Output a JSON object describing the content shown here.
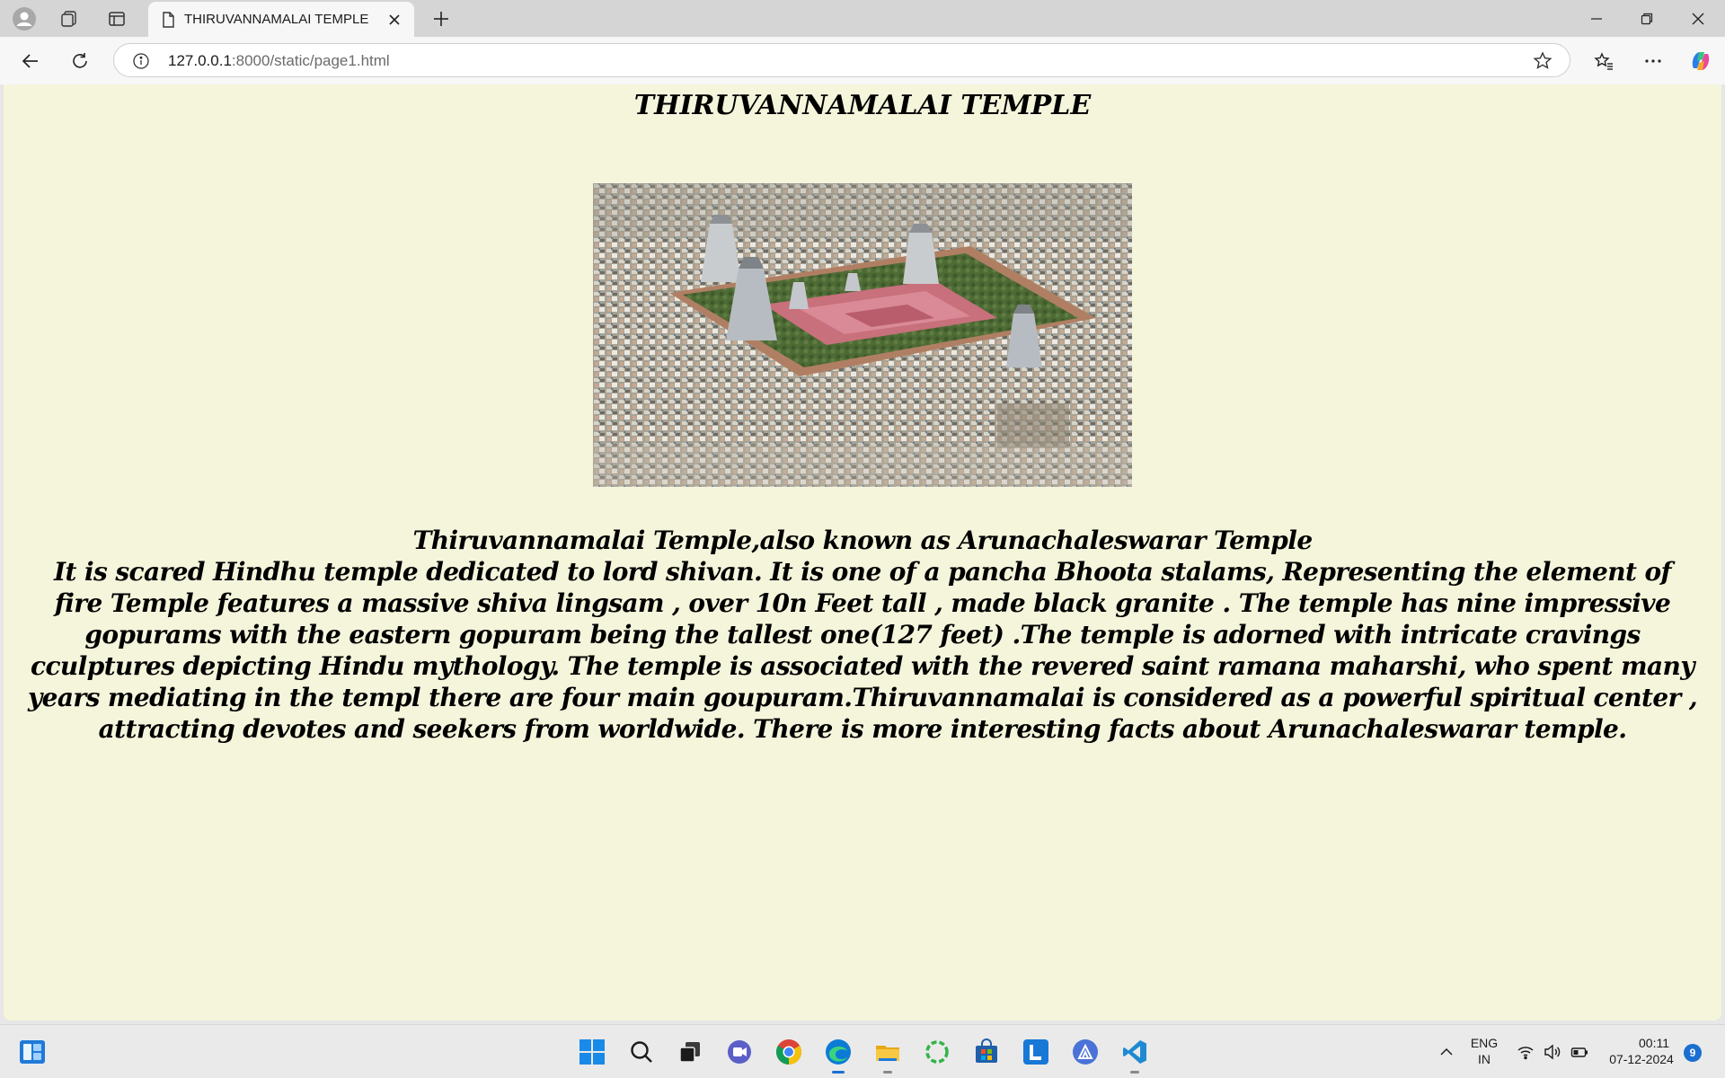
{
  "browser": {
    "tab_title": "THIRUVANNAMALAI TEMPLE",
    "url_host": "127.0.0.1",
    "url_path": ":8000/static/page1.html"
  },
  "page": {
    "heading": "THIRUVANNAMALAI TEMPLE",
    "image_alt": "Aerial view of Thiruvannamalai temple",
    "intro": "Thiruvannamalai Temple,also known as Arunachaleswarar Temple",
    "body": "It is scared Hindhu temple dedicated to lord shivan. It is one of a pancha Bhoota stalams, Representing the element of fire Temple features a massive shiva lingsam , over 10n Feet tall , made black granite . The temple has nine impressive gopurams with the eastern gopuram being the tallest one(127 feet) .The temple is adorned with intricate cravings cculptures depicting Hindu mythology. The temple is associated with the revered saint ramana maharshi, who spent many years mediating in the templ there are four main goupuram.Thiruvannamalai is considered as a powerful spiritual center , attracting devotes and seekers from worldwide. There is more interesting facts about Arunachaleswarar temple."
  },
  "taskbar": {
    "lang_top": "ENG",
    "lang_bottom": "IN",
    "time": "00:11",
    "date": "07-12-2024",
    "notification_count": "9",
    "icons": [
      "widgets-icon",
      "windows-start-icon",
      "search-icon",
      "task-view-icon",
      "teams-icon",
      "chrome-icon",
      "edge-icon",
      "file-explorer-icon",
      "app-ring-icon",
      "store-icon",
      "l-app-icon",
      "app-triangle-icon",
      "vscode-icon"
    ]
  },
  "colors": {
    "page_background": "#f5f5dc",
    "titlebar": "#d5d5d5",
    "toolbar": "#f7f7f7"
  }
}
